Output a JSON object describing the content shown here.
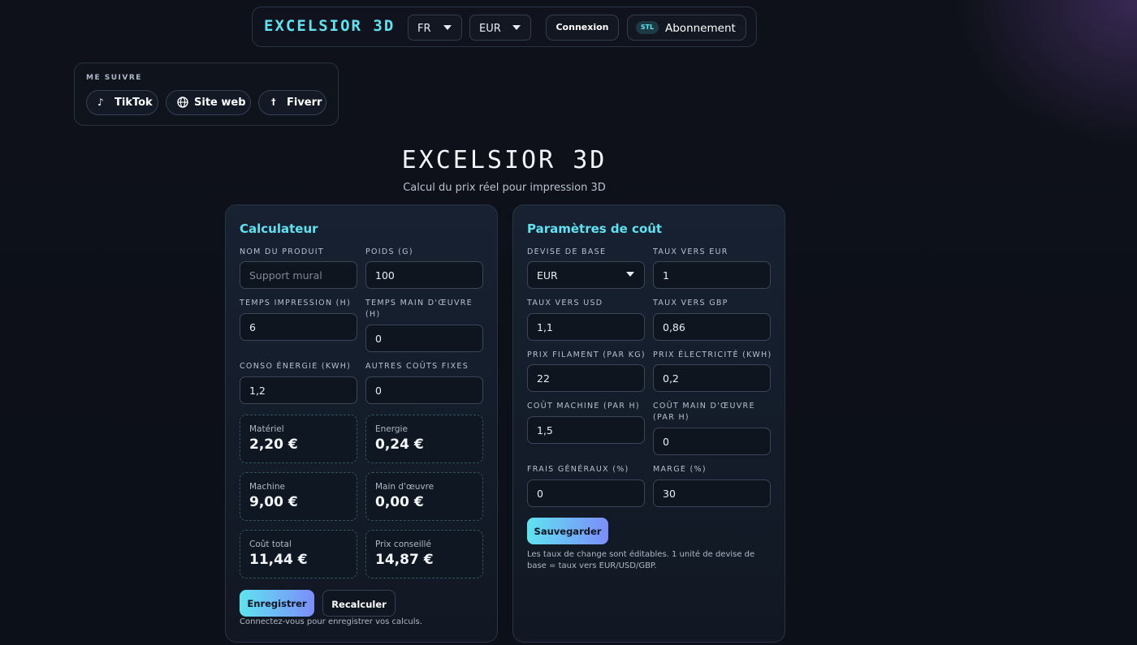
{
  "topbar": {
    "brand": "EXCELSIOR 3D",
    "language": "FR",
    "currency": "EUR",
    "login_label": "Connexion",
    "subscription_badge": "STL",
    "subscription_label": "Abonnement"
  },
  "follow": {
    "title": "ME SUIVRE",
    "links": [
      {
        "label": "TikTok",
        "icon": "tiktok-icon"
      },
      {
        "label": "Site web",
        "icon": "globe-icon"
      },
      {
        "label": "Fiverr",
        "icon": "fiverr-icon"
      }
    ]
  },
  "hero": {
    "title": "EXCELSIOR 3D",
    "subtitle": "Calcul du prix réel pour impression 3D"
  },
  "calculator": {
    "title": "Calculateur",
    "fields": {
      "product_name": {
        "label": "NOM DU PRODUIT",
        "placeholder": "Support mural"
      },
      "weight": {
        "label": "POIDS (G)",
        "value": "100"
      },
      "print_time": {
        "label": "TEMPS IMPRESSION (H)",
        "value": "6"
      },
      "labor_time": {
        "label": "TEMPS MAIN D'ŒUVRE (H)",
        "value": "0"
      },
      "energy": {
        "label": "CONSO ÉNERGIE (KWH)",
        "value": "1,2"
      },
      "other_fixed": {
        "label": "AUTRES COÛTS FIXES",
        "value": "0"
      }
    },
    "results": [
      {
        "label": "Matériel",
        "value": "2,20 €"
      },
      {
        "label": "Energie",
        "value": "0,24 €"
      },
      {
        "label": "Machine",
        "value": "9,00 €"
      },
      {
        "label": "Main d'œuvre",
        "value": "0,00 €"
      },
      {
        "label": "Coût total",
        "value": "11,44 €"
      },
      {
        "label": "Prix conseillé",
        "value": "14,87 €"
      }
    ],
    "save_label": "Enregistrer",
    "recalc_label": "Recalculer",
    "note": "Connectez-vous pour enregistrer vos calculs."
  },
  "settings": {
    "title": "Paramètres de coût",
    "fields": {
      "base_currency": {
        "label": "DEVISE DE BASE",
        "value": "EUR"
      },
      "rate_eur": {
        "label": "TAUX VERS EUR",
        "value": "1"
      },
      "rate_usd": {
        "label": "TAUX VERS USD",
        "value": "1,1"
      },
      "rate_gbp": {
        "label": "TAUX VERS GBP",
        "value": "0,86"
      },
      "filament_price": {
        "label": "PRIX FILAMENT (PAR KG)",
        "value": "22"
      },
      "electricity_price": {
        "label": "PRIX ÉLECTRICITÉ (KWH)",
        "value": "0,2"
      },
      "machine_cost": {
        "label": "COÛT MACHINE (PAR H)",
        "value": "1,5"
      },
      "labor_cost": {
        "label": "COÛT MAIN D'ŒUVRE (PAR H)",
        "value": "0"
      },
      "overhead": {
        "label": "FRAIS GÉNÉRAUX (%)",
        "value": "0"
      },
      "margin": {
        "label": "MARGE (%)",
        "value": "30"
      }
    },
    "save_label": "Sauvegarder",
    "note": "Les taux de change sont éditables. 1 unité de devise de base = taux vers EUR/USD/GBP."
  }
}
